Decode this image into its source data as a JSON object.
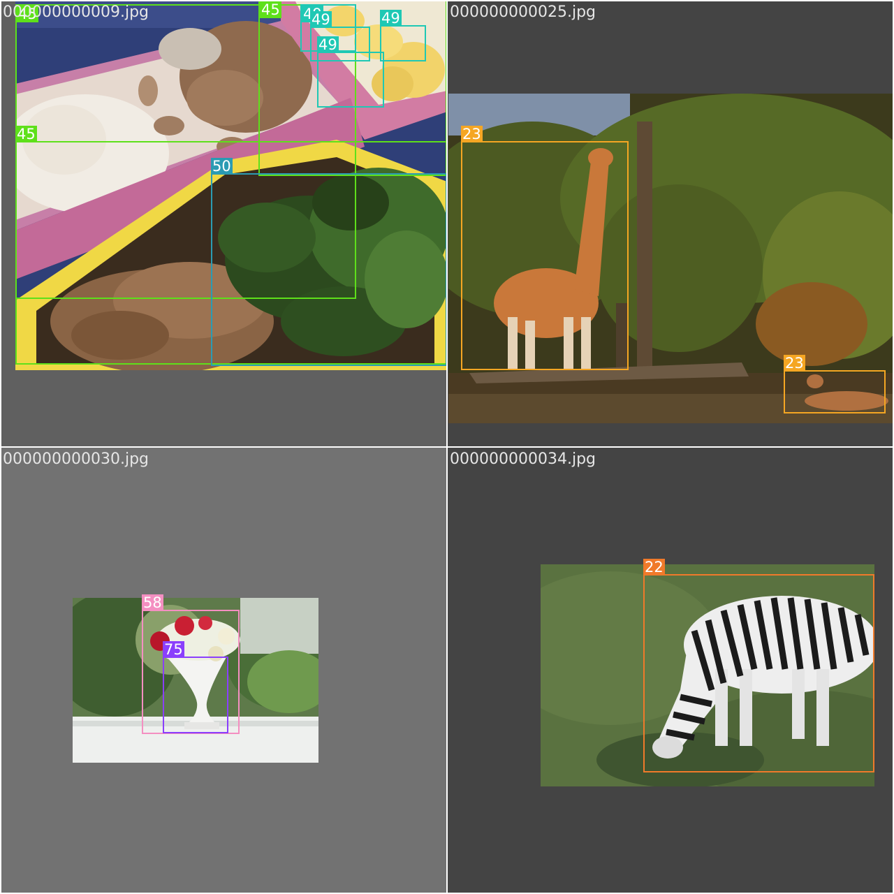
{
  "mosaic": {
    "tiles": [
      {
        "filename": "000000000009.jpg",
        "boxes": [
          {
            "label": "45",
            "color": "#5ee01a"
          },
          {
            "label": "45",
            "color": "#5ee01a"
          },
          {
            "label": "45",
            "color": "#5ee01a"
          },
          {
            "label": "49",
            "color": "#1fc8b4"
          },
          {
            "label": "49",
            "color": "#1fc8b4"
          },
          {
            "label": "49",
            "color": "#1fc8b4"
          },
          {
            "label": "49",
            "color": "#1fc8b4"
          },
          {
            "label": "50",
            "color": "#2b9bb3"
          }
        ]
      },
      {
        "filename": "000000000025.jpg",
        "boxes": [
          {
            "label": "23",
            "color": "#f5a623"
          },
          {
            "label": "23",
            "color": "#f5a623"
          }
        ]
      },
      {
        "filename": "000000000030.jpg",
        "boxes": [
          {
            "label": "58",
            "color": "#f48fc1"
          },
          {
            "label": "75",
            "color": "#8a3ffc"
          }
        ]
      },
      {
        "filename": "000000000034.jpg",
        "boxes": [
          {
            "label": "22",
            "color": "#f07a2a"
          }
        ]
      }
    ]
  },
  "colors": {
    "tile_bg_1": "#606060",
    "tile_bg_2": "#444444",
    "tile_bg_3": "#727272",
    "tile_bg_4": "#444444"
  },
  "photos": {
    "tile1": "bento-box-photo",
    "tile2": "giraffe-photo",
    "tile3": "flower-vase-photo",
    "tile4": "zebra-photo"
  }
}
